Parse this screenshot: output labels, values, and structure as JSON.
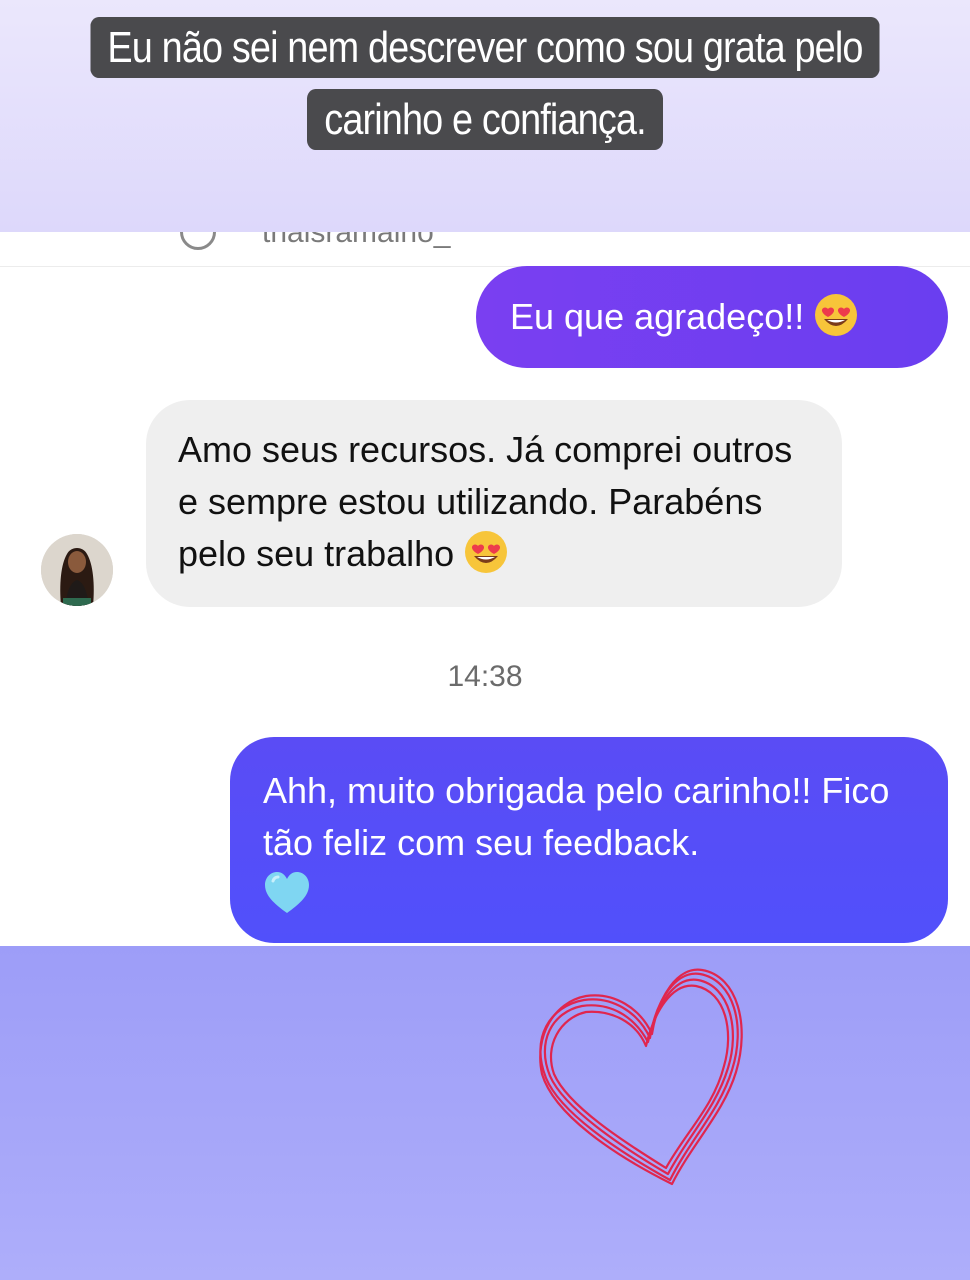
{
  "story": {
    "caption": "Eu não sei nem descrever como sou grata pelo carinho e confiança."
  },
  "header": {
    "username_fragment": "thaisramalho_"
  },
  "messages": [
    {
      "direction": "outgoing",
      "text": "Eu que agradeço!!",
      "emoji": "smiling-face-with-heart-eyes"
    },
    {
      "direction": "incoming",
      "text": "Amo seus recursos. Já comprei outros e sempre estou utilizando. Parabéns pelo seu trabalho",
      "emoji": "smiling-face-with-heart-eyes"
    },
    {
      "direction": "outgoing",
      "text": "Ahh, muito obrigada pelo carinho!! Fico tão feliz com seu feedback.",
      "emoji": "light-blue-heart"
    }
  ],
  "timestamp": "14:38",
  "colors": {
    "outgoing_bubble_1": "#7440f1",
    "outgoing_bubble_2": "#5550f8",
    "incoming_bubble": "#efefef",
    "caption_background": "#4a4a4d",
    "doodle_heart": "#e0264e",
    "bottom_band": "#a3a3f9"
  }
}
